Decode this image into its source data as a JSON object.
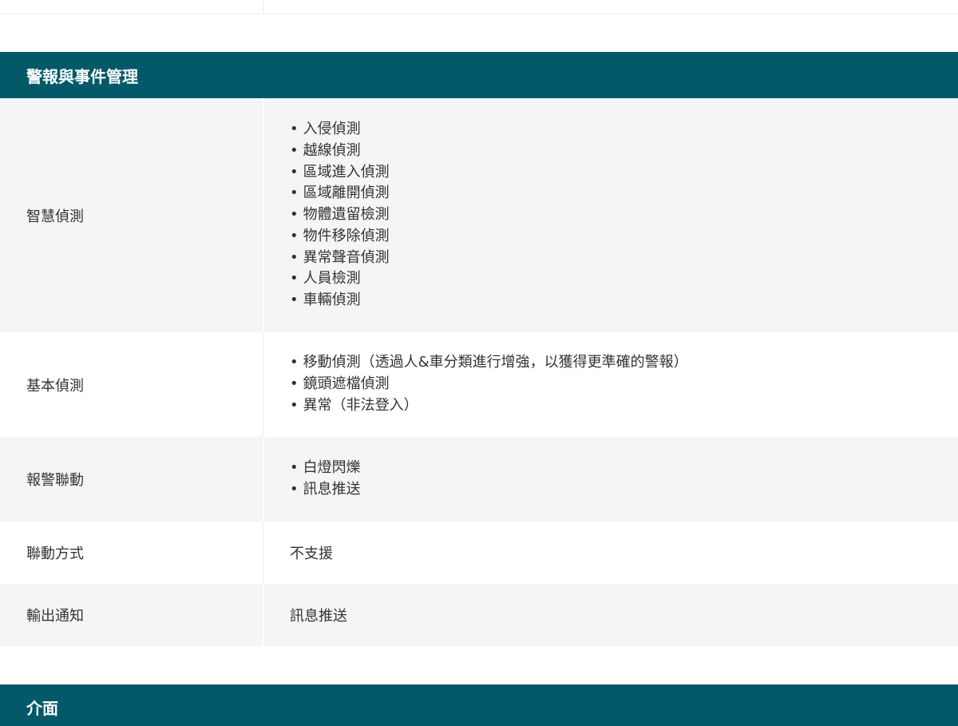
{
  "sections": [
    {
      "title": "警報與事件管理",
      "rows": [
        {
          "label": "智慧偵測",
          "items": [
            "入侵偵測",
            "越線偵測",
            "區域進入偵測",
            "區域離開偵測",
            "物體遺留檢測",
            "物件移除偵測",
            "異常聲音偵測",
            "人員檢測",
            "車輛偵測"
          ]
        },
        {
          "label": "基本偵測",
          "items": [
            "移動偵測（透過人&車分類進行增強，以獲得更準確的警報）",
            "鏡頭遮檔偵測",
            "異常（非法登入）"
          ]
        },
        {
          "label": "報警聯動",
          "items": [
            "白燈閃爍",
            "訊息推送"
          ]
        },
        {
          "label": "聯動方式",
          "value": "不支援"
        },
        {
          "label": "輸出通知",
          "value": "訊息推送"
        }
      ]
    },
    {
      "title": "介面"
    }
  ]
}
